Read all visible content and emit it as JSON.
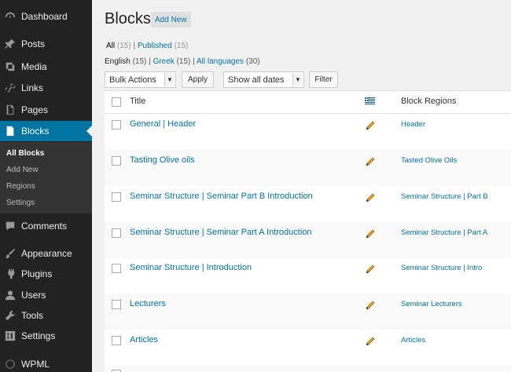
{
  "sidebar": {
    "items": [
      {
        "label": "Dashboard",
        "icon": "dashboard-icon"
      },
      {
        "label": "Posts",
        "icon": "pin-icon"
      },
      {
        "label": "Media",
        "icon": "media-icon"
      },
      {
        "label": "Links",
        "icon": "link-icon"
      },
      {
        "label": "Pages",
        "icon": "page-icon"
      },
      {
        "label": "Blocks",
        "icon": "blocks-icon"
      },
      {
        "label": "Comments",
        "icon": "comment-icon"
      },
      {
        "label": "Appearance",
        "icon": "brush-icon"
      },
      {
        "label": "Plugins",
        "icon": "plugin-icon"
      },
      {
        "label": "Users",
        "icon": "user-icon"
      },
      {
        "label": "Tools",
        "icon": "wrench-icon"
      },
      {
        "label": "Settings",
        "icon": "settings-icon"
      },
      {
        "label": "WPML",
        "icon": "wpml-icon"
      }
    ],
    "submenu": [
      "All Blocks",
      "Add New",
      "Regions",
      "Settings"
    ]
  },
  "header": {
    "title": "Blocks",
    "add_new": "Add New"
  },
  "filters": {
    "all_label": "All",
    "all_count": "(15)",
    "sep": "|",
    "published_label": "Published",
    "published_count": "(15)",
    "english_label": "English",
    "english_count": "(15)",
    "greek_label": "Greek",
    "greek_count": "(15)",
    "all_languages_label": "All languages",
    "all_languages_count": "(30)"
  },
  "toolbar": {
    "bulk_actions": "Bulk Actions",
    "apply": "Apply",
    "dates": "Show all dates",
    "filter": "Filter",
    "arrow": "▼"
  },
  "table": {
    "col_title": "Title",
    "col_regions": "Block Regions",
    "rows": [
      {
        "title": "General | Header",
        "region": "Header"
      },
      {
        "title": "Tasting Olive oils",
        "region": "Tasted Olive Oils"
      },
      {
        "title": "Seminar Structure | Seminar Part B Introduction",
        "region": "Seminar Structure | Part B"
      },
      {
        "title": "Seminar Structure | Seminar Part A Introduction",
        "region": "Seminar Structure | Part A"
      },
      {
        "title": "Seminar Structure | Introduction",
        "region": "Seminar Structure | Intro"
      },
      {
        "title": "Lecturers",
        "region": "Seminar Lecturers"
      },
      {
        "title": "Articles",
        "region": "Articles"
      }
    ]
  },
  "colors": {
    "sidebar_bg": "#222222",
    "active_bg": "#0074a2",
    "link": "#0074a2"
  }
}
